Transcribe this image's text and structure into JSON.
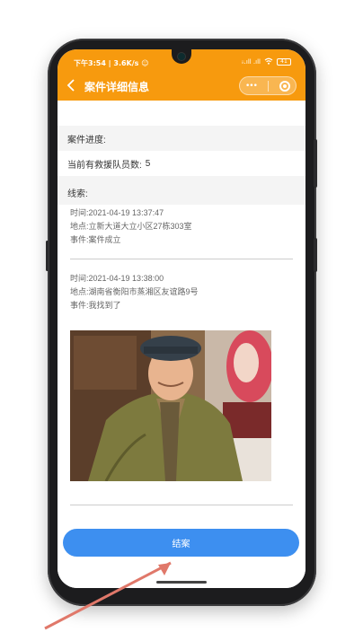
{
  "status_bar": {
    "time_speed": "下午3:54 | 3.6K/s ☺",
    "signal_text": "ᵢᵢ.ıll .ıll",
    "battery": "41"
  },
  "nav": {
    "back_icon": "chevron-left-icon",
    "title": "案件详细信息",
    "more_icon": "•••",
    "close_icon": "target-circle-icon"
  },
  "progress_section": {
    "heading": "案件进度:",
    "rescuer_count_label": "当前有救援队员数:",
    "rescuer_count": "5"
  },
  "clues_section": {
    "heading": "线索:",
    "items": [
      {
        "time_label": "时间:",
        "time": "2021-04-19 13:37:47",
        "place_label": "地点:",
        "place": "立新大道大立小区27栋303室",
        "event_label": "事件:",
        "event": "案件成立"
      },
      {
        "time_label": "时间:",
        "time": "2021-04-19 13:38:00",
        "place_label": "地点:",
        "place": "湖南省衡阳市蒸湘区友谊路9号",
        "event_label": "事件:",
        "event": "我找到了"
      }
    ]
  },
  "actions": {
    "close_case_label": "结案"
  },
  "colors": {
    "header": "#f79a0e",
    "button": "#3d8ff0",
    "arrow": "#e0786a"
  }
}
